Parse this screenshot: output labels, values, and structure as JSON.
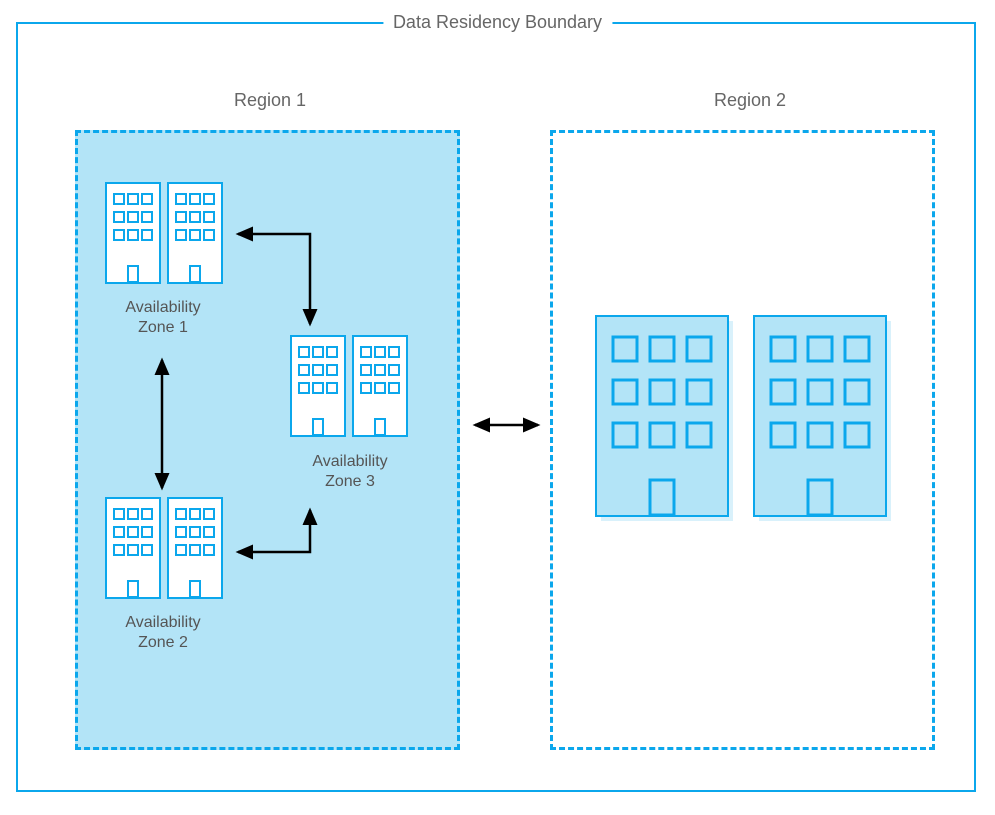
{
  "boundary_label": "Data Residency Boundary",
  "regions": {
    "r1": {
      "title": "Region 1"
    },
    "r2": {
      "title": "Region 2"
    }
  },
  "zones": {
    "z1": {
      "label_line1": "Availability",
      "label_line2": "Zone 1"
    },
    "z2": {
      "label_line1": "Availability",
      "label_line2": "Zone 2"
    },
    "z3": {
      "label_line1": "Availability",
      "label_line2": "Zone 3"
    }
  },
  "colors": {
    "azure_blue": "#0ba7ec",
    "light_fill": "#b3e4f7",
    "pale_fill": "#d9f1fb",
    "arrow": "#000000"
  }
}
